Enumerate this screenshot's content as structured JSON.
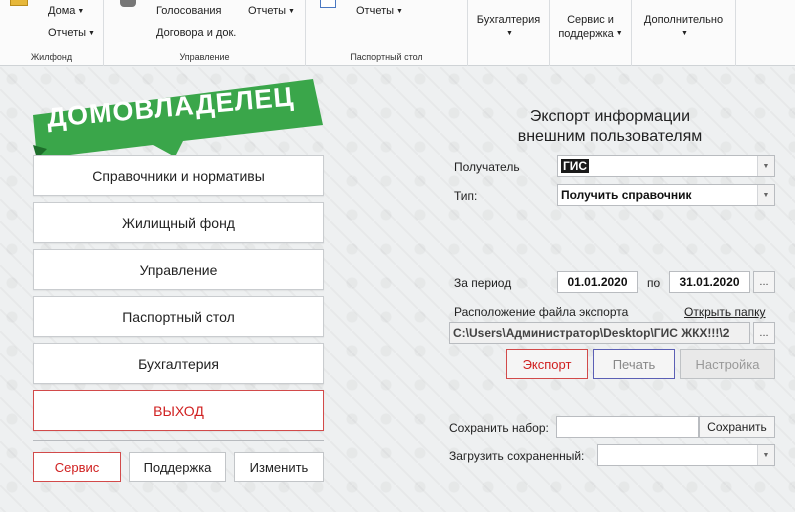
{
  "ribbon": {
    "housing": {
      "caption": "Жилфонд",
      "items": [
        {
          "label": "Дома"
        },
        {
          "label": "Отчеты"
        }
      ]
    },
    "management": {
      "caption": "Управление",
      "items": [
        {
          "label": "Голосования"
        },
        {
          "label": "Отчеты"
        },
        {
          "label": "Договора и док."
        }
      ]
    },
    "passport": {
      "caption": "Паспортный стол",
      "items": [
        {
          "label": "Отчеты"
        }
      ]
    },
    "accounting": {
      "label": "Бухгалтерия"
    },
    "service": {
      "label_line1": "Сервис и",
      "label_line2": "поддержка"
    },
    "extra": {
      "label": "Дополнительно"
    }
  },
  "logo": {
    "text": "ДОМОВЛАДЕЛЕЦ",
    "color": "#3aa64a"
  },
  "menu": {
    "items": [
      {
        "label": "Справочники и нормативы"
      },
      {
        "label": "Жилищный фонд"
      },
      {
        "label": "Управление"
      },
      {
        "label": "Паспортный стол"
      },
      {
        "label": "Бухгалтерия"
      }
    ],
    "exit_label": "ВЫХОД",
    "service_label": "Сервис",
    "support_label": "Поддержка",
    "change_label": "Изменить"
  },
  "export": {
    "title_line1": "Экспорт информации",
    "title_line2": "внешним пользователям",
    "recipient_label": "Получатель",
    "recipient_value": "ГИС",
    "type_label": "Тип:",
    "type_value": "Получить справочник",
    "period_label": "За период",
    "date_from": "01.01.2020",
    "to_label": "по",
    "date_to": "31.01.2020",
    "dots": "...",
    "file_location_label": "Расположение файла экспорта",
    "open_folder_link": "Открыть папку",
    "file_path": "C:\\Users\\Администратор\\Desktop\\ГИС ЖКХ!!!\\2",
    "export_button": "Экспорт",
    "print_button": "Печать",
    "settings_button": "Настройка",
    "save_set_label": "Сохранить набор:",
    "save_button": "Сохранить",
    "load_saved_label": "Загрузить сохраненный:"
  },
  "colors": {
    "accent_red": "#d24a4a",
    "brand_green": "#3aa64a"
  }
}
